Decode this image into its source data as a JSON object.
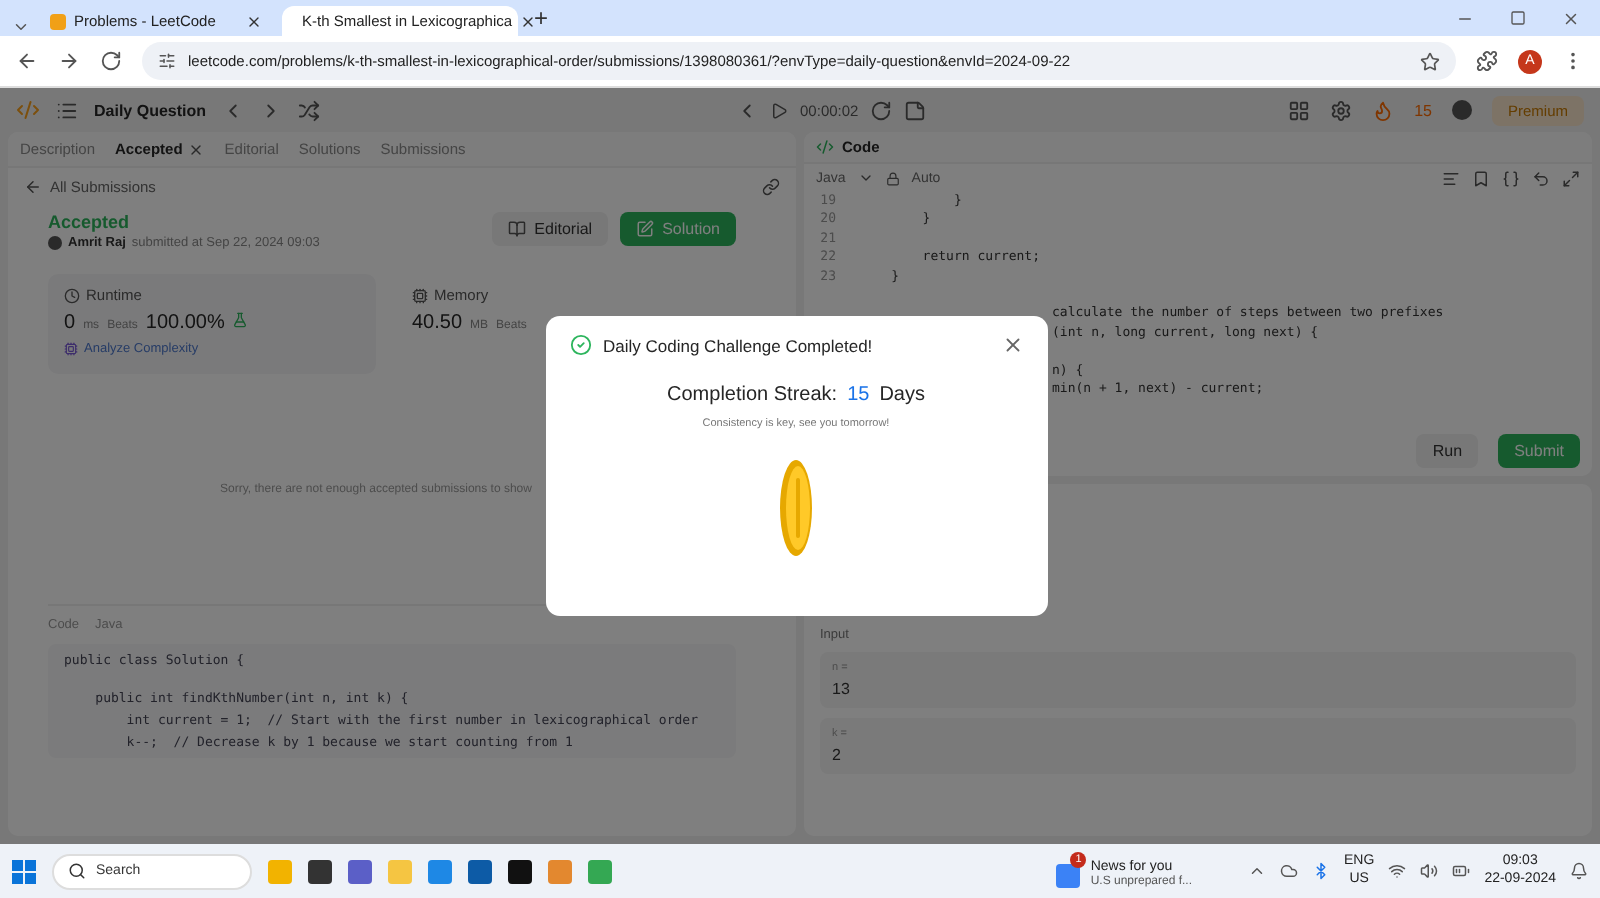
{
  "browser": {
    "tabs": [
      {
        "title": "Problems - LeetCode",
        "selected": false
      },
      {
        "title": "K-th Smallest in Lexicographica",
        "selected": true
      }
    ],
    "new_tab": "+",
    "url": "leetcode.com/problems/k-th-smallest-in-lexicographical-order/submissions/1398080361/?envType=daily-question&envId=2024-09-22",
    "profile": "A"
  },
  "nav": {
    "title": "Daily Question",
    "timer": "00:00:02",
    "streak": "15",
    "premium": "Premium"
  },
  "left_tabs": [
    {
      "label": "Description",
      "selected": false,
      "closable": false
    },
    {
      "label": "Accepted",
      "selected": true,
      "closable": true
    },
    {
      "label": "Editorial",
      "selected": false,
      "closable": false
    },
    {
      "label": "Solutions",
      "selected": false,
      "closable": false
    },
    {
      "label": "Submissions",
      "selected": false,
      "closable": false
    }
  ],
  "back_link": "All Submissions",
  "submission": {
    "status": "Accepted",
    "user": "Amrit Raj",
    "submitted": "submitted at Sep 22, 2024 09:03",
    "editorial": "Editorial",
    "solution": "Solution"
  },
  "runtime": {
    "label": "Runtime",
    "value": "0",
    "unit": "ms",
    "beats_label": "Beats",
    "beats": "100.00%",
    "analyze": "Analyze Complexity"
  },
  "memory": {
    "label": "Memory",
    "value": "40.50",
    "unit": "MB",
    "beats_label": "Beats"
  },
  "notice": "Sorry, there are not enough accepted submissions to show",
  "code_view": {
    "label": "Code",
    "language": "Java",
    "lines": [
      "public class Solution {",
      "    public int findKthNumber(int n, int k) {",
      "        int current = 1;  // Start with the first number in lexicographical order",
      "        k--;  // Decrease k by 1 because we start counting from 1"
    ]
  },
  "editor": {
    "title": "Code",
    "language": "Java",
    "mode": "Auto",
    "lines": [
      {
        "number": "19",
        "text": "            }"
      },
      {
        "number": "20",
        "text": "        }"
      },
      {
        "number": "21"
      },
      {
        "number": "22",
        "text": "        return current;"
      },
      {
        "number": "23",
        "text": "    }"
      }
    ],
    "fragments": [
      "calculate the number of steps between two prefixes",
      "(int n, long current, long next) {",
      "n) {",
      "min(n + 1, next) - current;"
    ],
    "run": "Run",
    "submit": "Submit"
  },
  "testcase": {
    "label": "Input",
    "params": [
      {
        "name": "n =",
        "value": "13"
      },
      {
        "name": "k =",
        "value": "2"
      }
    ]
  },
  "modal": {
    "title": "Daily Coding Challenge Completed!",
    "streak_label": "Completion Streak:",
    "streak_count": "15",
    "streak_unit": "Days",
    "message": "Consistency is key, see you tomorrow!"
  },
  "taskbar": {
    "search": "Search",
    "news_badge": "1",
    "news_title": "News for you",
    "news_text": "U.S unprepared f...",
    "lang": "ENG",
    "region": "US",
    "time": "09:03",
    "date": "22-09-2024"
  }
}
